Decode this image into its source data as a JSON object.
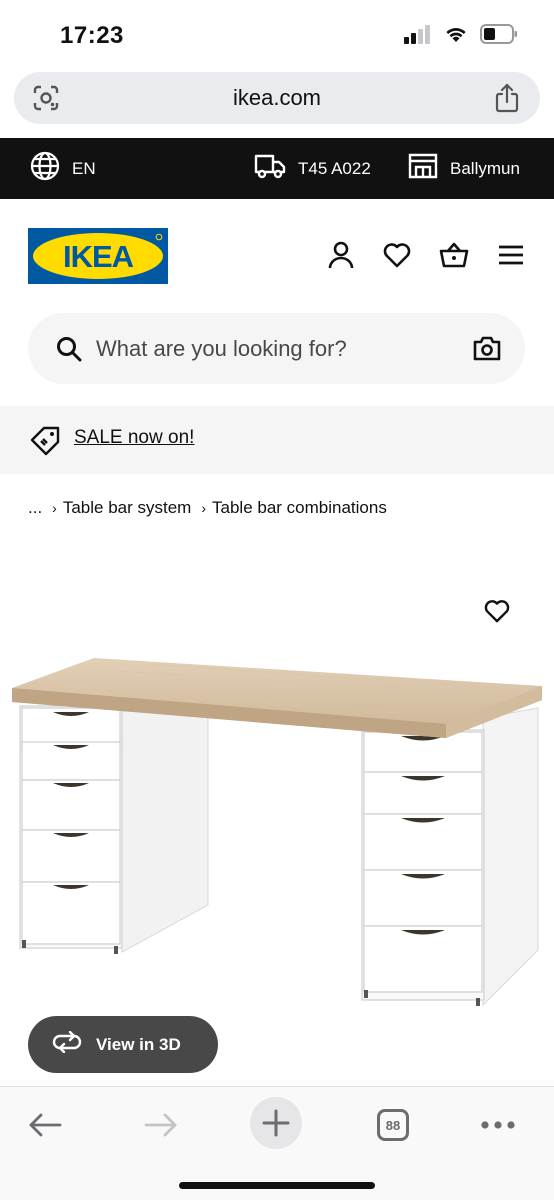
{
  "status_bar": {
    "time": "17:23"
  },
  "browser": {
    "url": "ikea.com"
  },
  "utility_bar": {
    "language": "EN",
    "delivery_code": "T45 A022",
    "store": "Ballymun"
  },
  "header": {
    "logo_text": "IKEA"
  },
  "search": {
    "placeholder": "What are you looking for?"
  },
  "sale_banner": {
    "text": "SALE now on!"
  },
  "breadcrumb": {
    "ellipsis": "...",
    "items": [
      "Table bar system",
      "Table bar combinations"
    ]
  },
  "product": {
    "view_3d_label": "View in 3D"
  },
  "toolbar": {
    "tab_count": "88"
  },
  "icons": {
    "wifi": "wifi-icon",
    "battery": "battery-icon",
    "signal": "signal-icon",
    "lens": "google-lens-icon",
    "share": "share-icon",
    "globe": "globe-icon",
    "truck": "truck-icon",
    "store": "store-icon",
    "account": "person-icon",
    "favourites": "heart-icon",
    "basket": "basket-icon",
    "menu": "hamburger-icon",
    "search": "search-icon",
    "camera": "camera-icon",
    "tag": "tag-icon",
    "rotate": "rotate-3d-icon",
    "back": "arrow-left-icon",
    "forward": "arrow-right-icon",
    "new_tab": "plus-icon",
    "more": "more-icon"
  },
  "colors": {
    "ikea_blue": "#0058A3",
    "ikea_yellow": "#FFDB00",
    "utility_bar": "#111111",
    "view_3d_button": "#484848"
  }
}
